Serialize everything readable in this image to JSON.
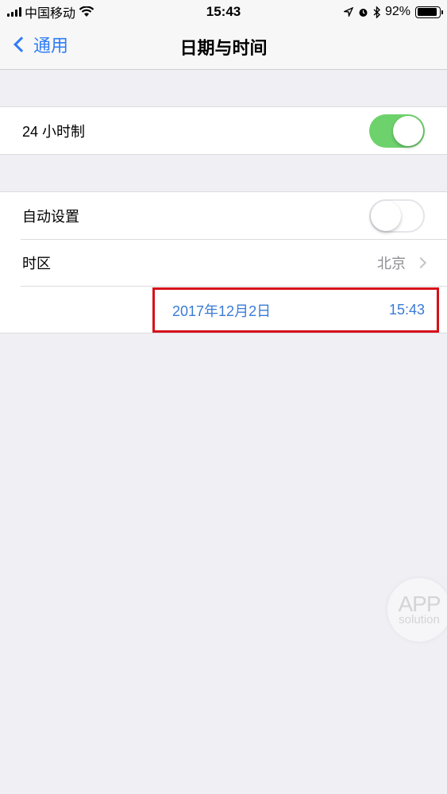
{
  "status_bar": {
    "carrier": "中国移动",
    "time": "15:43",
    "battery_percent": "92%",
    "battery_level": 0.92,
    "icons": [
      "signal-icon",
      "wifi-icon",
      "location-icon",
      "alarm-icon",
      "bluetooth-icon",
      "battery-icon"
    ]
  },
  "nav": {
    "back_label": "通用",
    "title": "日期与时间"
  },
  "settings": {
    "hour24": {
      "label": "24 小时制",
      "on": true
    },
    "auto_set": {
      "label": "自动设置",
      "on": false
    },
    "timezone": {
      "label": "时区",
      "value": "北京"
    },
    "datetime": {
      "date": "2017年12月2日",
      "time": "15:43"
    }
  },
  "colors": {
    "accent": "#2f7cf6",
    "toggle_on": "#6dd26c",
    "highlight_box": "#d6111a",
    "datetime_text": "#3a7bd5"
  },
  "watermark": {
    "top": "APP",
    "bottom": "solution"
  }
}
